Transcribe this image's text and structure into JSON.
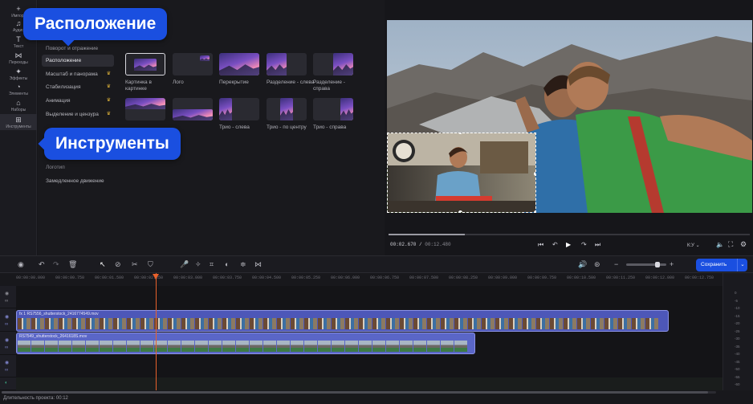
{
  "sidebar": {
    "items": [
      {
        "icon": "plus-icon",
        "label": "Импорт"
      },
      {
        "icon": "music-icon",
        "label": "Аудио"
      },
      {
        "icon": "text-icon",
        "label": "Текст"
      },
      {
        "icon": "transitions-icon",
        "label": "Переходы"
      },
      {
        "icon": "effects-icon",
        "label": "Эффекты"
      },
      {
        "icon": "elements-icon",
        "label": "Элементы"
      },
      {
        "icon": "sets-icon",
        "label": "Наборы"
      },
      {
        "icon": "tools-icon",
        "label": "Инструменты"
      }
    ]
  },
  "callouts": {
    "layout": "Расположение",
    "tools": "Инструменты"
  },
  "menu": {
    "rotate": "Поворот и отражение",
    "items": [
      {
        "label": "Расположение",
        "crown": false
      },
      {
        "label": "Масштаб и панорама",
        "crown": true
      },
      {
        "label": "Стабилизация",
        "crown": true
      },
      {
        "label": "Анимация",
        "crown": true
      },
      {
        "label": "Выделение и цензура",
        "crown": true
      },
      {
        "label": "Логотип",
        "crown": false
      },
      {
        "label": "Замедленное движение",
        "crown": false
      }
    ]
  },
  "layouts": [
    {
      "label": "Картинка в картинке"
    },
    {
      "label": "Лого"
    },
    {
      "label": "Перекрытие"
    },
    {
      "label": "Разделение - слева"
    },
    {
      "label": "Разделение - справа"
    },
    {
      "label": ""
    },
    {
      "label": ""
    },
    {
      "label": "Трио - слева"
    },
    {
      "label": "Трио - по центру"
    },
    {
      "label": "Трио - справа"
    }
  ],
  "player": {
    "current_time": "00:02.670",
    "total_time": "00:12.480",
    "progress": 0.21,
    "ratio_label": "К:У"
  },
  "toolbar": {
    "save_label": "Сохранить"
  },
  "ruler": {
    "labels": [
      "00:00:00.000",
      "00:00:00.750",
      "00:00:01.500",
      "00:00:02.250",
      "00:00:03.000",
      "00:00:03.750",
      "00:00:04.500",
      "00:00:05.250",
      "00:00:06.000",
      "00:00:06.750",
      "00:00:07.500",
      "00:00:08.250",
      "00:00:09.000",
      "00:00:09.750",
      "00:00:10.500",
      "00:00:11.250",
      "00:00:12.000",
      "00:00:12.750"
    ]
  },
  "clips": {
    "clip1": "RS7556_shutterstock_2416774549.mov",
    "clip1_prefix": "fx  1",
    "clip2": "RS7549_shutterstock_2641618S.mov"
  },
  "vu": {
    "labels": [
      "0",
      "-5",
      "-10",
      "-15",
      "-20",
      "-25",
      "-30",
      "-35",
      "-40",
      "-45",
      "-50",
      "-55",
      "-60"
    ]
  },
  "status": {
    "duration": "Длительность проекта: 00:12"
  },
  "colors": {
    "accent": "#1a4fe0",
    "clip1": "#4d57b8",
    "clip2": "#5a66c7",
    "playhead": "#e8612c"
  }
}
